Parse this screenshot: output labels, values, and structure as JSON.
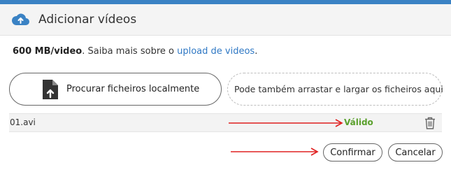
{
  "header": {
    "title": "Adicionar vídeos",
    "icon": "cloud-upload-icon",
    "accent_color": "#3a82c4"
  },
  "info": {
    "size_limit": "600 MB/video",
    "text": ". Saiba mais sobre o ",
    "link_text": "upload de videos",
    "suffix": "."
  },
  "upload": {
    "browse_label": "Procurar ficheiros localmente",
    "browse_icon": "file-upload-icon",
    "drop_label": "Pode também arrastar e largar os ficheiros aqui"
  },
  "files": [
    {
      "name": "01.avi",
      "status": "Válido",
      "status_color": "#5aa02c"
    }
  ],
  "actions": {
    "confirm_label": "Confirmar",
    "cancel_label": "Cancelar"
  },
  "annotation_color": "#e02020"
}
